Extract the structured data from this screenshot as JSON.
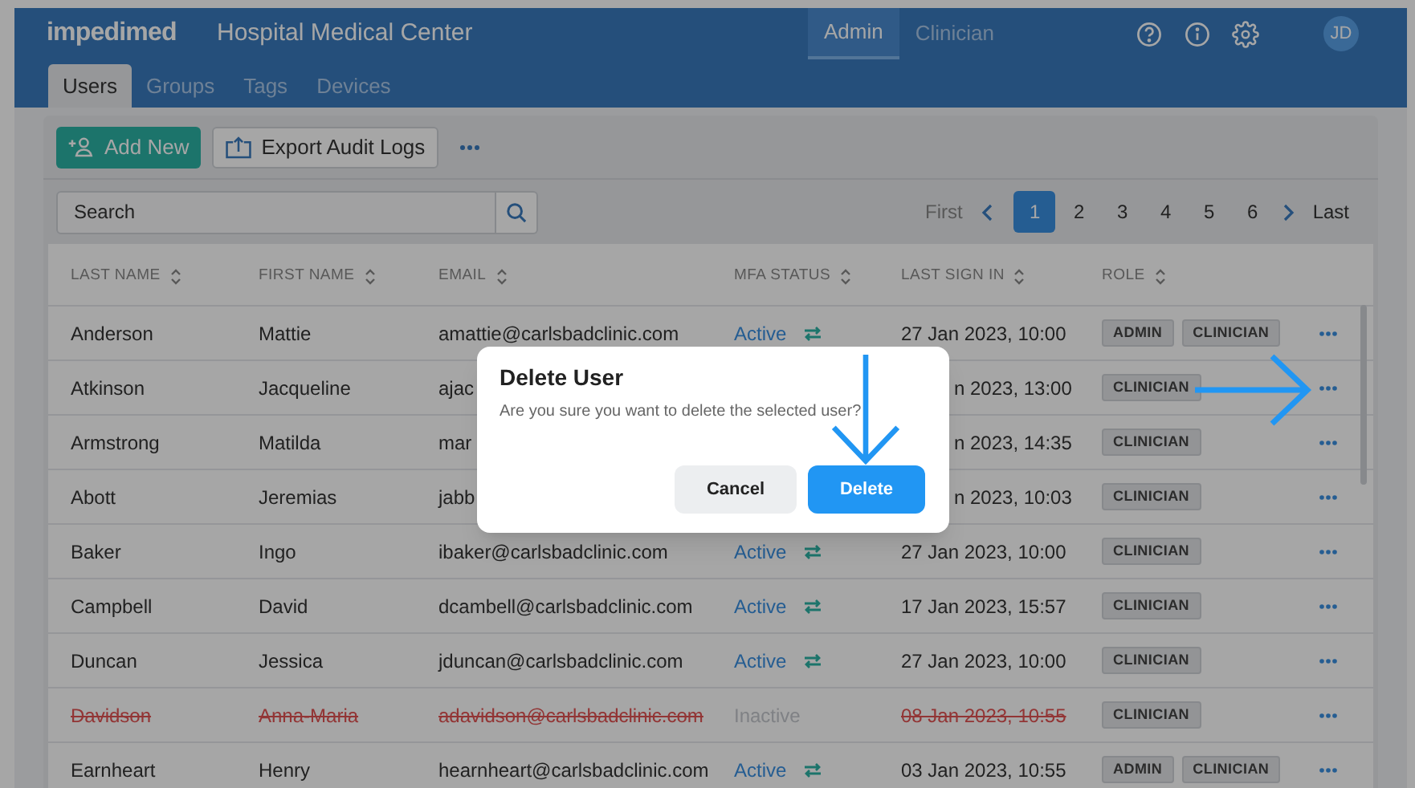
{
  "header": {
    "logo": "impedimed",
    "title": "Hospital Medical Center",
    "modes": [
      {
        "label": "Admin",
        "selected": true
      },
      {
        "label": "Clinician",
        "selected": false
      }
    ],
    "avatar": "JD"
  },
  "tabs": [
    {
      "label": "Users",
      "selected": true
    },
    {
      "label": "Groups",
      "selected": false
    },
    {
      "label": "Tags",
      "selected": false
    },
    {
      "label": "Devices",
      "selected": false
    }
  ],
  "toolbar": {
    "add_button": "Add New",
    "export_button": "Export Audit Logs"
  },
  "search": {
    "placeholder": "Search"
  },
  "pagination": {
    "first": "First",
    "last": "Last",
    "pages": [
      {
        "label": "1",
        "selected": true
      },
      {
        "label": "2",
        "selected": false
      },
      {
        "label": "3",
        "selected": false
      },
      {
        "label": "4",
        "selected": false
      },
      {
        "label": "5",
        "selected": false
      },
      {
        "label": "6",
        "selected": false
      }
    ]
  },
  "table": {
    "columns": [
      "LAST NAME",
      "FIRST NAME",
      "EMAIL",
      "MFA STATUS",
      "LAST SIGN IN",
      "ROLE"
    ],
    "rows": [
      {
        "last_name": "Anderson",
        "first_name": "Mattie",
        "email": "amattie@carlsbadclinic.com",
        "mfa": "Active",
        "mfa_active": true,
        "last_sign_in": "27 Jan 2023, 10:00",
        "roles": [
          "ADMIN",
          "CLINICIAN"
        ],
        "deleted": false
      },
      {
        "last_name": "Atkinson",
        "first_name": "Jacqueline",
        "email": "ajac",
        "last_sign_in": "n 2023, 13:00",
        "roles": [
          "CLINICIAN"
        ],
        "deleted": false
      },
      {
        "last_name": "Armstrong",
        "first_name": "Matilda",
        "email": "mar",
        "last_sign_in": "n 2023, 14:35",
        "roles": [
          "CLINICIAN"
        ],
        "deleted": false
      },
      {
        "last_name": "Abott",
        "first_name": "Jeremias",
        "email": "jabb",
        "last_sign_in": "n 2023, 10:03",
        "roles": [
          "CLINICIAN"
        ],
        "deleted": false
      },
      {
        "last_name": "Baker",
        "first_name": "Ingo",
        "email": "ibaker@carlsbadclinic.com",
        "mfa": "Active",
        "mfa_active": true,
        "last_sign_in": "27 Jan 2023, 10:00",
        "roles": [
          "CLINICIAN"
        ],
        "deleted": false
      },
      {
        "last_name": "Campbell",
        "first_name": "David",
        "email": "dcambell@carlsbadclinic.com",
        "mfa": "Active",
        "mfa_active": true,
        "last_sign_in": "17 Jan 2023, 15:57",
        "roles": [
          "CLINICIAN"
        ],
        "deleted": false
      },
      {
        "last_name": "Duncan",
        "first_name": "Jessica",
        "email": "jduncan@carlsbadclinic.com",
        "mfa": "Active",
        "mfa_active": true,
        "last_sign_in": "27 Jan 2023, 10:00",
        "roles": [
          "CLINICIAN"
        ],
        "deleted": false
      },
      {
        "last_name": "Davidson",
        "first_name": "Anna-Maria",
        "email": "adavidson@carlsbadclinic.com",
        "mfa": "Inactive",
        "mfa_active": false,
        "last_sign_in": "08 Jan 2023, 10:55",
        "roles": [
          "CLINICIAN"
        ],
        "deleted": true
      },
      {
        "last_name": "Earnheart",
        "first_name": "Henry",
        "email": "hearnheart@carlsbadclinic.com",
        "mfa": "Active",
        "mfa_active": true,
        "last_sign_in": "03 Jan 2023, 10:55",
        "roles": [
          "ADMIN",
          "CLINICIAN"
        ],
        "deleted": false
      }
    ]
  },
  "dialog": {
    "title": "Delete User",
    "message": "Are you sure you want to delete the selected user?",
    "cancel": "Cancel",
    "confirm": "Delete"
  }
}
